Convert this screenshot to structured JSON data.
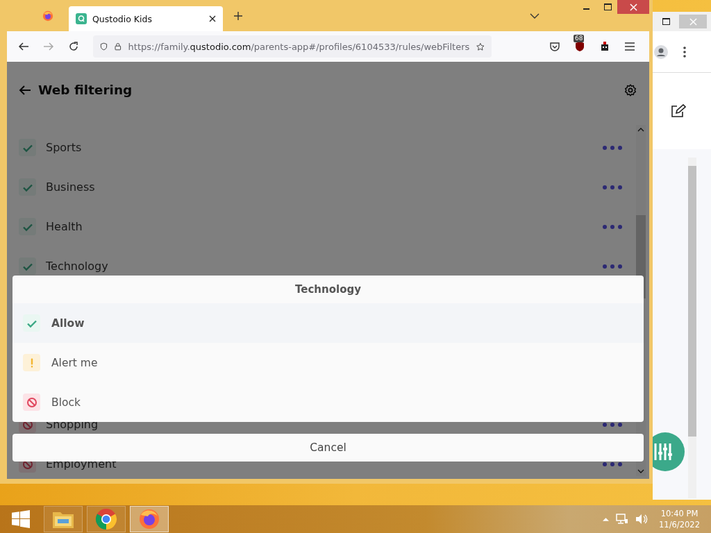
{
  "browser": {
    "tab_title": "Qustodio Kids",
    "url_prefix": "https://family.",
    "url_domain": "qustodio.com",
    "url_path": "/parents-app#/profiles/6104533/rules/webFilters",
    "extension_badge": "68"
  },
  "page": {
    "title": "Web filtering"
  },
  "categories": {
    "rows_top": [
      {
        "name": "Sports",
        "kind": "allow"
      },
      {
        "name": "Business",
        "kind": "allow"
      },
      {
        "name": "Health",
        "kind": "allow"
      },
      {
        "name": "Technology",
        "kind": "allow"
      }
    ],
    "rows_bottom": [
      {
        "name": "Shopping",
        "kind": "block"
      },
      {
        "name": "Employment",
        "kind": "block"
      }
    ]
  },
  "action_sheet": {
    "title": "Technology",
    "options": [
      {
        "label": "Allow",
        "kind": "allow",
        "selected": true
      },
      {
        "label": "Alert me",
        "kind": "alert",
        "selected": false
      },
      {
        "label": "Block",
        "kind": "block",
        "selected": false
      }
    ],
    "cancel": "Cancel"
  },
  "taskbar": {
    "time": "10:40 PM",
    "date": "11/6/2022"
  }
}
